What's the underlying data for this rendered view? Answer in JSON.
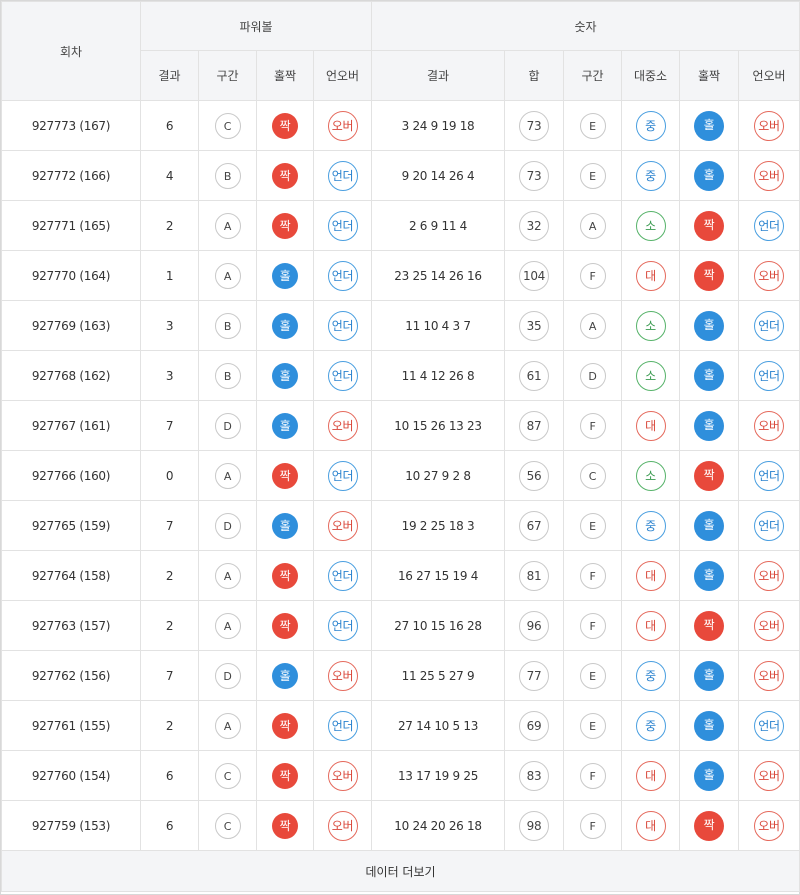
{
  "headers": {
    "round": "회차",
    "powerball_group": "파워볼",
    "numbers_group": "숫자",
    "pb_result": "결과",
    "pb_section": "구간",
    "pb_oddeven": "홀짝",
    "pb_underover": "언오버",
    "num_result": "결과",
    "num_sum": "합",
    "num_section": "구간",
    "num_size": "대중소",
    "num_oddeven": "홀짝",
    "num_underover": "언오버"
  },
  "colors": {
    "red": "#e8493b",
    "blue": "#2f8fdc",
    "green": "#3a9a50",
    "header_bg": "#f4f5f7"
  },
  "rows": [
    {
      "round": "927773 (167)",
      "pb": "6",
      "pb_sec": "C",
      "pb_oe": "짝",
      "pb_uo": "오버",
      "nums": "3 24 9 19 18",
      "sum": "73",
      "sec": "E",
      "size": "중",
      "oe": "홀",
      "uo": "오버"
    },
    {
      "round": "927772 (166)",
      "pb": "4",
      "pb_sec": "B",
      "pb_oe": "짝",
      "pb_uo": "언더",
      "nums": "9 20 14 26 4",
      "sum": "73",
      "sec": "E",
      "size": "중",
      "oe": "홀",
      "uo": "오버"
    },
    {
      "round": "927771 (165)",
      "pb": "2",
      "pb_sec": "A",
      "pb_oe": "짝",
      "pb_uo": "언더",
      "nums": "2 6 9 11 4",
      "sum": "32",
      "sec": "A",
      "size": "소",
      "oe": "짝",
      "uo": "언더"
    },
    {
      "round": "927770 (164)",
      "pb": "1",
      "pb_sec": "A",
      "pb_oe": "홀",
      "pb_uo": "언더",
      "nums": "23 25 14 26 16",
      "sum": "104",
      "sec": "F",
      "size": "대",
      "oe": "짝",
      "uo": "오버"
    },
    {
      "round": "927769 (163)",
      "pb": "3",
      "pb_sec": "B",
      "pb_oe": "홀",
      "pb_uo": "언더",
      "nums": "11 10 4 3 7",
      "sum": "35",
      "sec": "A",
      "size": "소",
      "oe": "홀",
      "uo": "언더"
    },
    {
      "round": "927768 (162)",
      "pb": "3",
      "pb_sec": "B",
      "pb_oe": "홀",
      "pb_uo": "언더",
      "nums": "11 4 12 26 8",
      "sum": "61",
      "sec": "D",
      "size": "소",
      "oe": "홀",
      "uo": "언더"
    },
    {
      "round": "927767 (161)",
      "pb": "7",
      "pb_sec": "D",
      "pb_oe": "홀",
      "pb_uo": "오버",
      "nums": "10 15 26 13 23",
      "sum": "87",
      "sec": "F",
      "size": "대",
      "oe": "홀",
      "uo": "오버"
    },
    {
      "round": "927766 (160)",
      "pb": "0",
      "pb_sec": "A",
      "pb_oe": "짝",
      "pb_uo": "언더",
      "nums": "10 27 9 2 8",
      "sum": "56",
      "sec": "C",
      "size": "소",
      "oe": "짝",
      "uo": "언더"
    },
    {
      "round": "927765 (159)",
      "pb": "7",
      "pb_sec": "D",
      "pb_oe": "홀",
      "pb_uo": "오버",
      "nums": "19 2 25 18 3",
      "sum": "67",
      "sec": "E",
      "size": "중",
      "oe": "홀",
      "uo": "언더"
    },
    {
      "round": "927764 (158)",
      "pb": "2",
      "pb_sec": "A",
      "pb_oe": "짝",
      "pb_uo": "언더",
      "nums": "16 27 15 19 4",
      "sum": "81",
      "sec": "F",
      "size": "대",
      "oe": "홀",
      "uo": "오버"
    },
    {
      "round": "927763 (157)",
      "pb": "2",
      "pb_sec": "A",
      "pb_oe": "짝",
      "pb_uo": "언더",
      "nums": "27 10 15 16 28",
      "sum": "96",
      "sec": "F",
      "size": "대",
      "oe": "짝",
      "uo": "오버"
    },
    {
      "round": "927762 (156)",
      "pb": "7",
      "pb_sec": "D",
      "pb_oe": "홀",
      "pb_uo": "오버",
      "nums": "11 25 5 27 9",
      "sum": "77",
      "sec": "E",
      "size": "중",
      "oe": "홀",
      "uo": "오버"
    },
    {
      "round": "927761 (155)",
      "pb": "2",
      "pb_sec": "A",
      "pb_oe": "짝",
      "pb_uo": "언더",
      "nums": "27 14 10 5 13",
      "sum": "69",
      "sec": "E",
      "size": "중",
      "oe": "홀",
      "uo": "언더"
    },
    {
      "round": "927760 (154)",
      "pb": "6",
      "pb_sec": "C",
      "pb_oe": "짝",
      "pb_uo": "오버",
      "nums": "13 17 19 9 25",
      "sum": "83",
      "sec": "F",
      "size": "대",
      "oe": "홀",
      "uo": "오버"
    },
    {
      "round": "927759 (153)",
      "pb": "6",
      "pb_sec": "C",
      "pb_oe": "짝",
      "pb_uo": "오버",
      "nums": "10 24 20 26 18",
      "sum": "98",
      "sec": "F",
      "size": "대",
      "oe": "짝",
      "uo": "오버"
    }
  ],
  "more_button": "데이터 더보기"
}
